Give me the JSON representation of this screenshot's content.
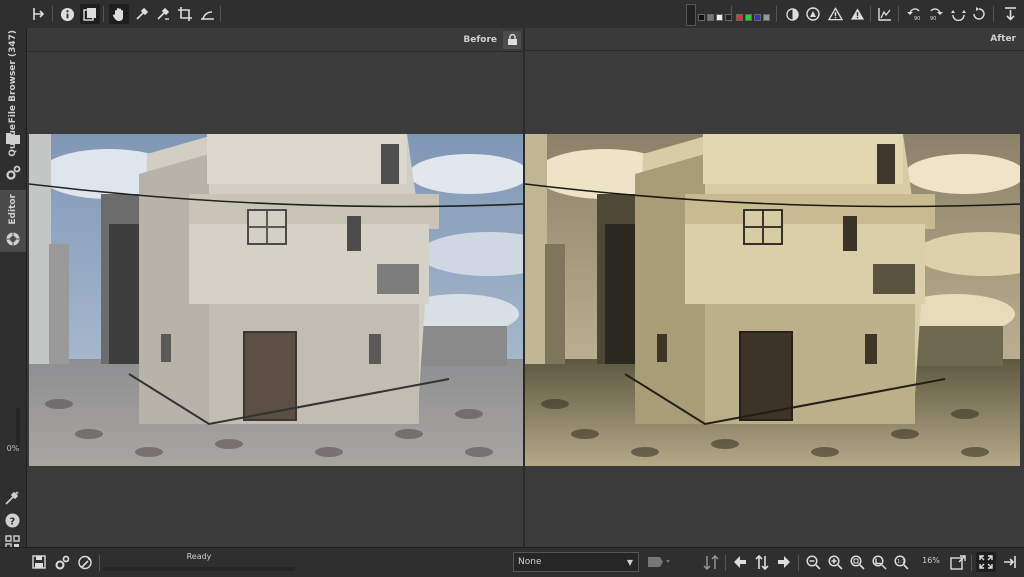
{
  "left_panel": {
    "tabs": [
      {
        "label": "File Browser (347)",
        "icon": "folder-icon"
      },
      {
        "label": "Queue",
        "icon": "gears-icon"
      },
      {
        "label": "Editor",
        "icon": "aperture-icon"
      }
    ],
    "progress_label": "0%"
  },
  "preview": {
    "before_label": "Before",
    "after_label": "After"
  },
  "status": {
    "text": "Ready",
    "progress": 0
  },
  "bottom": {
    "profile_select": "None",
    "zoom_level": "16%"
  },
  "colors": {
    "toolbar_bg": "#2f2f2f",
    "main_bg": "#3a3a3a",
    "accent_red": "#d33",
    "accent_green": "#3c3",
    "accent_blue": "#33c"
  }
}
